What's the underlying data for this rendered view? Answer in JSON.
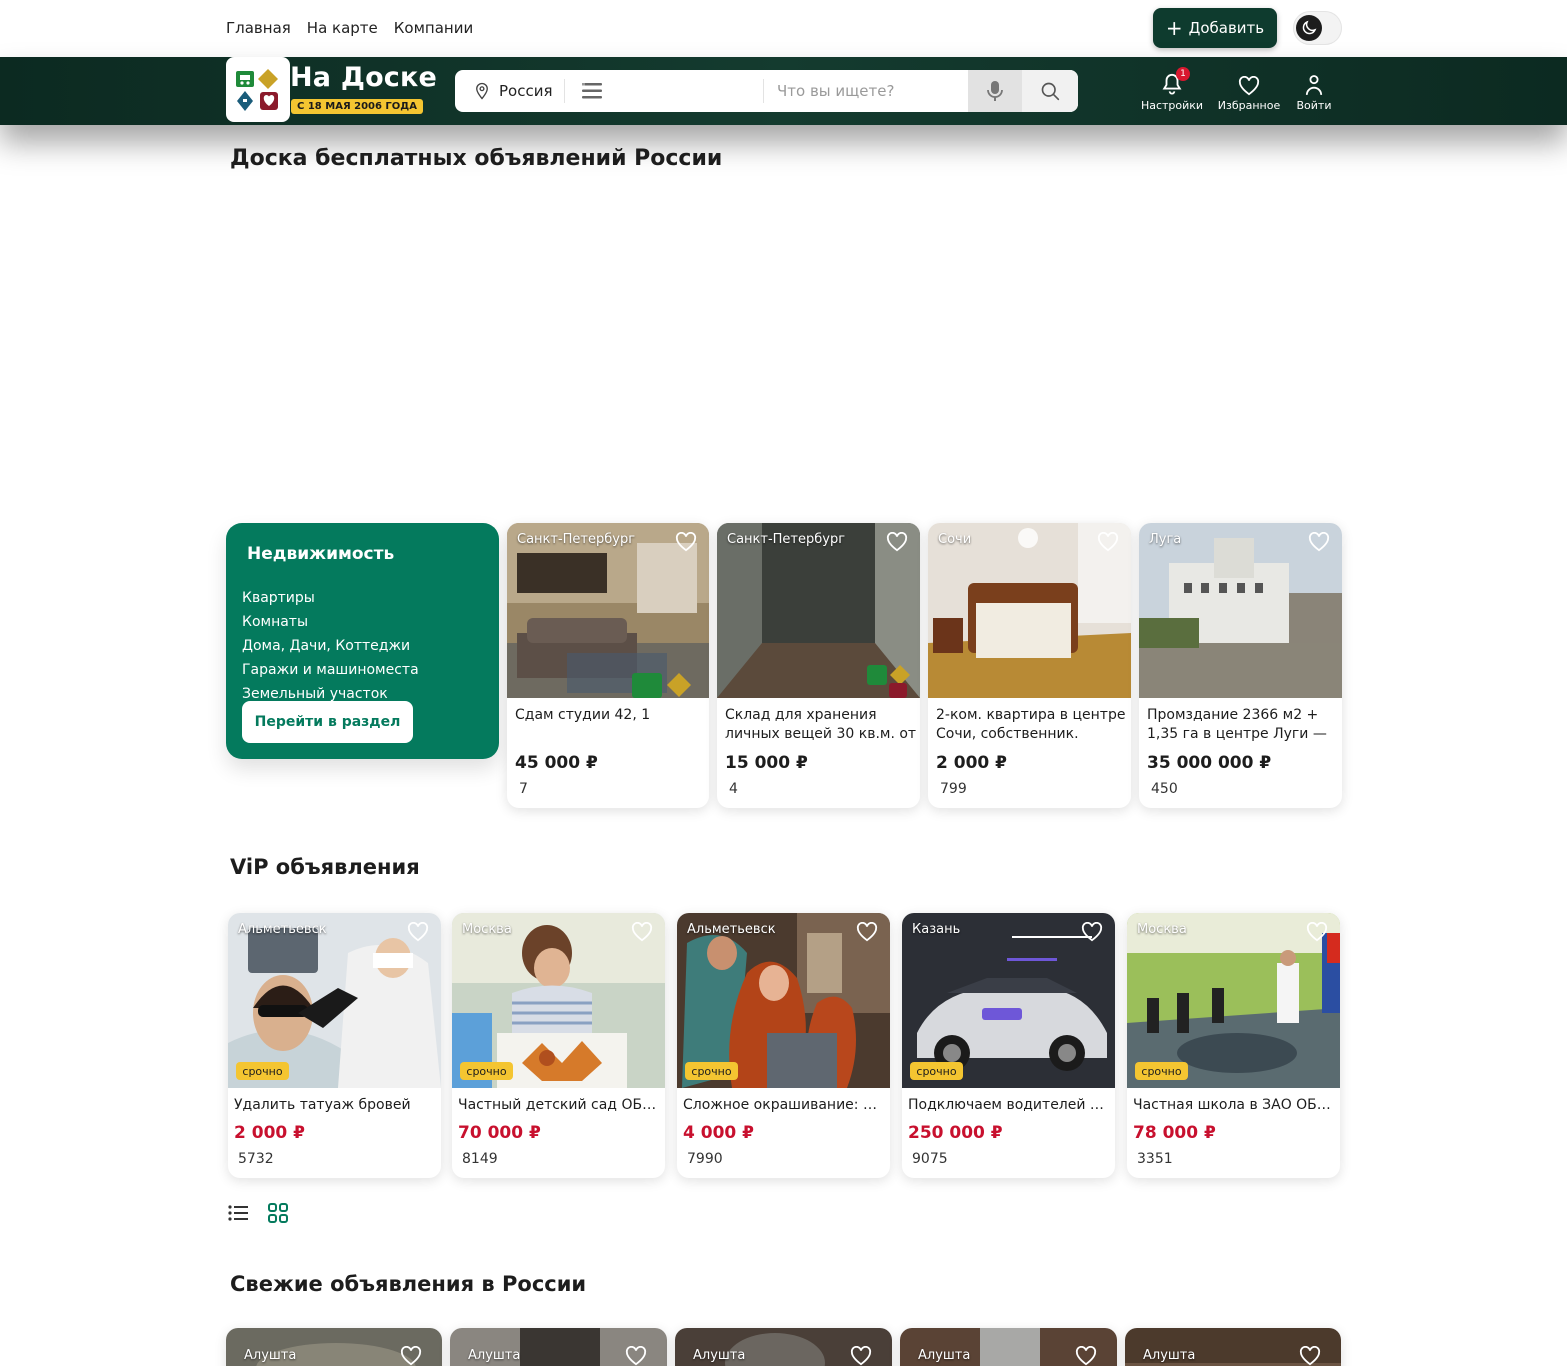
{
  "topnav": {
    "items": [
      "Главная",
      "На карте",
      "Компании"
    ]
  },
  "add_button": "Добавить",
  "logo": {
    "title": "На Доске",
    "badge": "С 18 МАЯ 2006 ГОДА"
  },
  "search": {
    "region": "Россия",
    "placeholder": "Что вы ищете?"
  },
  "header_icons": {
    "settings": "Настройки",
    "settings_badge": "1",
    "favorites": "Избранное",
    "login": "Войти"
  },
  "page_title": "Доска бесплатных объявлений России",
  "category": {
    "title": "Недвижимость",
    "links": [
      "Квартиры",
      "Комнаты",
      "Дома, Дачи, Коттеджи",
      "Гаражи и машиноместа",
      "Земельный участок"
    ],
    "button": "Перейти в раздел"
  },
  "realty_cards": [
    {
      "city": "Санкт-Петербург",
      "title": "Сдам студии 42, 1",
      "price": "45 000 ₽",
      "views": "7"
    },
    {
      "city": "Санкт-Петербург",
      "title": "Склад для хранения личных вещей 30 кв.м. от",
      "price": "15 000 ₽",
      "views": "4"
    },
    {
      "city": "Сочи",
      "title": "2-ком. квартира в центре Сочи, собственник.",
      "price": "2 000 ₽",
      "views": "799"
    },
    {
      "city": "Луга",
      "title": "Промздание 2366 м2 + 1,35 га в центре Луги —",
      "price": "35 000 000 ₽",
      "views": "450"
    }
  ],
  "vip": {
    "title": "ViP объявления",
    "urgent_label": "срочно",
    "cards": [
      {
        "city": "Альметьевск",
        "title": "Удалить татуаж бровей",
        "price": "2 000 ₽",
        "views": "5732"
      },
      {
        "city": "Москва",
        "title": "Частный детский сад ОБРА...",
        "price": "70 000 ₽",
        "views": "8149"
      },
      {
        "city": "Альметьевск",
        "title": "Сложное окрашивание: про...",
        "price": "4 000 ₽",
        "views": "7990"
      },
      {
        "city": "Казань",
        "title": "Подключаем водителей так...",
        "price": "250 000 ₽",
        "views": "9075"
      },
      {
        "city": "Москва",
        "title": "Частная школа в ЗАО ОБРА...",
        "price": "78 000 ₽",
        "views": "3351"
      }
    ]
  },
  "fresh": {
    "title": "Свежие объявления в России",
    "cities": [
      "Алушта",
      "Алушта",
      "Алушта",
      "Алушта",
      "Алушта"
    ]
  },
  "colors": {
    "brand_green": "#047a5d",
    "header_dark": "#0c2a21",
    "price_red": "#c8102e",
    "urgent_yellow": "#f4c531"
  }
}
